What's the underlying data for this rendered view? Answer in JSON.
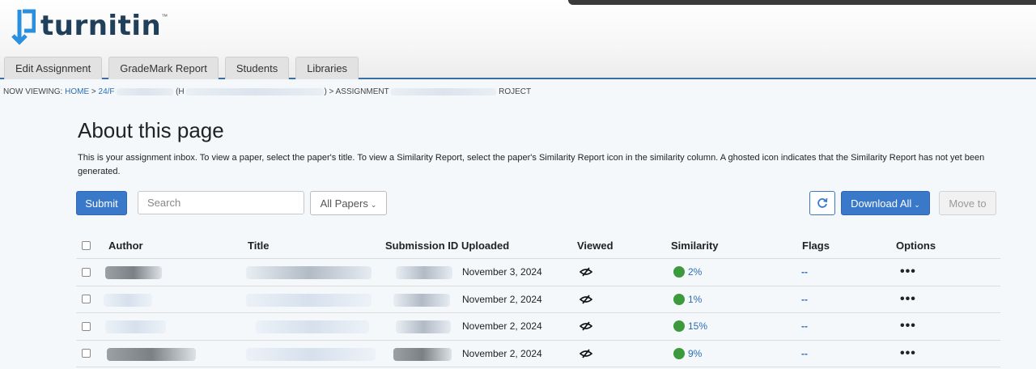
{
  "brand": {
    "name": "turnitin",
    "tm": "™"
  },
  "tabs": [
    {
      "label": "Edit Assignment"
    },
    {
      "label": "GradeMark Report"
    },
    {
      "label": "Students"
    },
    {
      "label": "Libraries"
    }
  ],
  "breadcrumb": {
    "prefix": "NOW VIEWING: ",
    "home": "HOME",
    "sep": " > ",
    "course_start": "24/F",
    "course_mid": "(H",
    "course_end": ") > ASSIGNMENT",
    "assignment_end": "ROJECT"
  },
  "page": {
    "title": "About this page",
    "description": "This is your assignment inbox. To view a paper, select the paper's title. To view a Similarity Report, select the paper's Similarity Report icon in the similarity column. A ghosted icon indicates that the Similarity Report has not yet been generated."
  },
  "toolbar": {
    "submit_label": "Submit",
    "search_placeholder": "Search",
    "filter_label": "All Papers",
    "download_label": "Download All",
    "move_label": "Move to",
    "caret": "⌄"
  },
  "table": {
    "columns": [
      "Author",
      "Title",
      "Submission ID",
      "Uploaded",
      "Viewed",
      "Similarity",
      "Flags",
      "Options"
    ],
    "rows": [
      {
        "uploaded": "November 3, 2024",
        "similarity": "2%",
        "flags": "--",
        "options": "•••"
      },
      {
        "uploaded": "November 2, 2024",
        "similarity": "1%",
        "flags": "--",
        "options": "•••"
      },
      {
        "uploaded": "November 2, 2024",
        "similarity": "15%",
        "flags": "--",
        "options": "•••"
      },
      {
        "uploaded": "November 2, 2024",
        "similarity": "9%",
        "flags": "--",
        "options": "•••"
      }
    ]
  },
  "colors": {
    "accent": "#3a78c9",
    "brand": "#1f3f5a",
    "similarity_green": "#3c9a3c",
    "link": "#2a6db5"
  }
}
